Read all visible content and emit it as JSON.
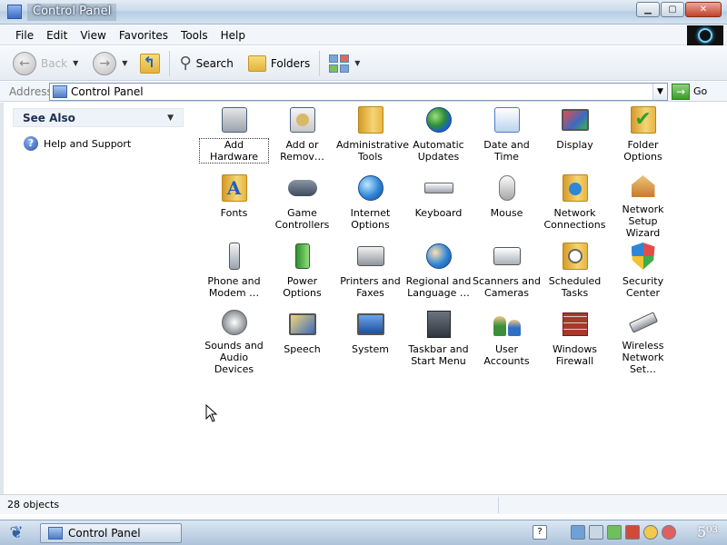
{
  "window": {
    "title": "Control Panel",
    "caption_buttons": {
      "minimize": "▁",
      "maximize": "▢",
      "close": "✕"
    }
  },
  "menu": [
    "File",
    "Edit",
    "View",
    "Favorites",
    "Tools",
    "Help"
  ],
  "toolbar": {
    "back_label": "Back",
    "search_label": "Search",
    "folders_label": "Folders"
  },
  "address": {
    "label": "Address",
    "value": "Control Panel",
    "go_label": "Go"
  },
  "see_also": {
    "header": "See Also",
    "items": [
      "Help and Support"
    ]
  },
  "items": [
    {
      "label": "Add Hardware",
      "icon": "hardware-icon"
    },
    {
      "label": "Add or\nRemov…",
      "icon": "add-remove-icon"
    },
    {
      "label": "Administrative\nTools",
      "icon": "admin-tools-icon"
    },
    {
      "label": "Automatic\nUpdates",
      "icon": "updates-globe-icon"
    },
    {
      "label": "Date and Time",
      "icon": "calendar-clock-icon"
    },
    {
      "label": "Display",
      "icon": "display-icon"
    },
    {
      "label": "Folder Options",
      "icon": "folder-options-icon"
    },
    {
      "label": "Fonts",
      "icon": "fonts-folder-icon"
    },
    {
      "label": "Game\nControllers",
      "icon": "gamepad-icon"
    },
    {
      "label": "Internet\nOptions",
      "icon": "internet-options-icon"
    },
    {
      "label": "Keyboard",
      "icon": "keyboard-icon"
    },
    {
      "label": "Mouse",
      "icon": "mouse-icon"
    },
    {
      "label": "Network\nConnections",
      "icon": "network-connections-icon"
    },
    {
      "label": "Network Setup\nWizard",
      "icon": "network-setup-icon"
    },
    {
      "label": "Phone and\nModem …",
      "icon": "phone-icon"
    },
    {
      "label": "Power Options",
      "icon": "battery-icon"
    },
    {
      "label": "Printers and\nFaxes",
      "icon": "printer-icon"
    },
    {
      "label": "Regional and\nLanguage …",
      "icon": "regional-globe-icon"
    },
    {
      "label": "Scanners and\nCameras",
      "icon": "scanner-camera-icon"
    },
    {
      "label": "Scheduled\nTasks",
      "icon": "scheduled-tasks-icon"
    },
    {
      "label": "Security\nCenter",
      "icon": "shield-icon"
    },
    {
      "label": "Sounds and\nAudio Devices",
      "icon": "speaker-icon"
    },
    {
      "label": "Speech",
      "icon": "speech-icon"
    },
    {
      "label": "System",
      "icon": "system-icon"
    },
    {
      "label": "Taskbar and\nStart Menu",
      "icon": "taskbar-icon"
    },
    {
      "label": "User Accounts",
      "icon": "users-icon"
    },
    {
      "label": "Windows\nFirewall",
      "icon": "firewall-icon"
    },
    {
      "label": "Wireless\nNetwork Set…",
      "icon": "wireless-icon"
    }
  ],
  "status": {
    "text": "28 objects"
  },
  "taskbar": {
    "button_label": "Control Panel",
    "clock": "5⁰³"
  },
  "colors": {
    "accent": "#3b6bc3",
    "window_bg": "#ffffff"
  }
}
